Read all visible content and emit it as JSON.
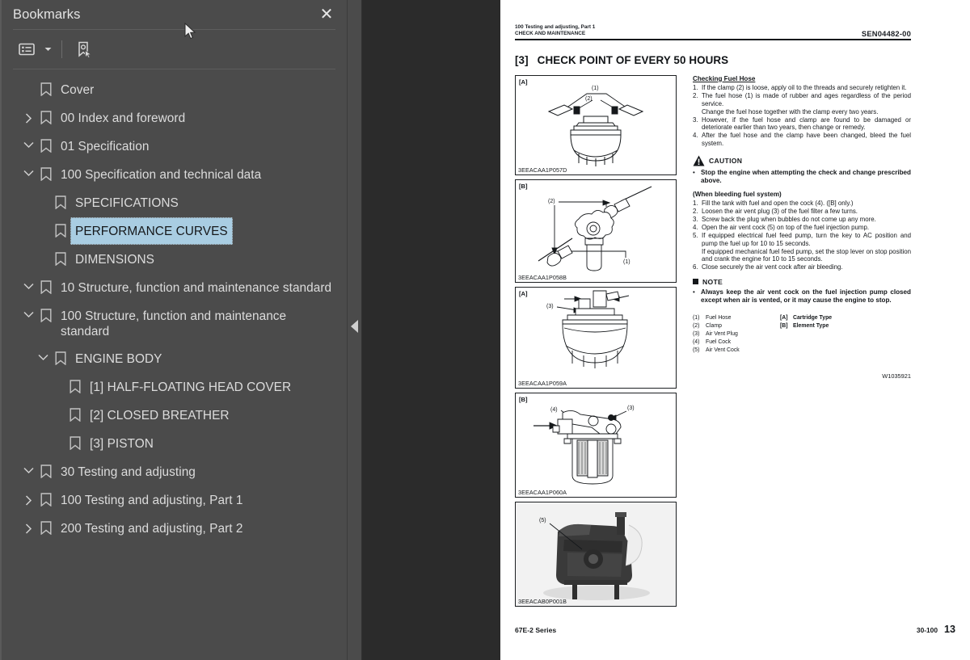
{
  "panel": {
    "title": "Bookmarks",
    "close_label": "✕",
    "toolbar": {
      "options_icon": "list-options-icon",
      "caret_icon": "chevron-down-icon",
      "find_bookmark_icon": "find-current-bookmark-icon"
    },
    "highlight_color": "#a9cde2",
    "items": [
      {
        "label": "Cover",
        "level": 1,
        "twisty": "none",
        "selected": false
      },
      {
        "label": "00 Index and foreword",
        "level": 0,
        "twisty": "collapsed",
        "selected": false
      },
      {
        "label": "01 Specification",
        "level": 0,
        "twisty": "expanded",
        "selected": false
      },
      {
        "label": "100 Specification and technical data",
        "level": 1,
        "twisty": "expanded",
        "selected": false
      },
      {
        "label": "SPECIFICATIONS",
        "level": 2,
        "twisty": "none",
        "selected": false
      },
      {
        "label": "PERFORMANCE CURVES",
        "level": 2,
        "twisty": "none",
        "selected": true
      },
      {
        "label": "DIMENSIONS",
        "level": 2,
        "twisty": "none",
        "selected": false
      },
      {
        "label": "10 Structure, function and maintenance standard",
        "level": 0,
        "twisty": "expanded",
        "selected": false
      },
      {
        "label": "100 Structure, function and maintenance standard",
        "level": 1,
        "twisty": "expanded",
        "selected": false
      },
      {
        "label": "ENGINE BODY",
        "level": 2,
        "twisty": "expanded",
        "selected": false
      },
      {
        "label": "[1] HALF-FLOATING HEAD COVER",
        "level": 3,
        "twisty": "none",
        "selected": false
      },
      {
        "label": "[2] CLOSED BREATHER",
        "level": 3,
        "twisty": "none",
        "selected": false
      },
      {
        "label": "[3] PISTON",
        "level": 3,
        "twisty": "none",
        "selected": false
      },
      {
        "label": "30 Testing and adjusting",
        "level": 0,
        "twisty": "expanded",
        "selected": false
      },
      {
        "label": "100 Testing and adjusting, Part 1",
        "level": 1,
        "twisty": "collapsed",
        "selected": false
      },
      {
        "label": "200 Testing and adjusting, Part 2",
        "level": 1,
        "twisty": "collapsed",
        "selected": false
      }
    ]
  },
  "viewer": {
    "collapse_handle_icon": "collapse-left-triangle-icon"
  },
  "document": {
    "header": {
      "line1": "100 Testing and adjusting, Part 1",
      "line2": "CHECK AND MAINTENANCE",
      "doc_number": "SEN04482-00"
    },
    "section": {
      "number": "[3]",
      "title": "CHECK POINT OF EVERY 50 HOURS"
    },
    "figures": [
      {
        "tag": "[A]",
        "code": "3EEACAA1P057D",
        "callouts": [
          "(1)",
          "(2)"
        ],
        "caption": "cartridge-type fuel filter with clamps"
      },
      {
        "tag": "[B]",
        "code": "3EEACAA1P058B",
        "callouts": [
          "(2)",
          "(1)"
        ],
        "caption": "element-type fuel filter with hoses"
      },
      {
        "tag": "[A]",
        "code": "3EEACAA1P059A",
        "callouts": [
          "(3)"
        ],
        "caption": "cartridge fuel filter air vent plug"
      },
      {
        "tag": "[B]",
        "code": "3EEACAA1P060A",
        "callouts": [
          "(4)",
          "(3)"
        ],
        "caption": "element fuel filter cut-away"
      },
      {
        "tag": "",
        "code": "3EEACAB0P001B",
        "callouts": [
          "(5)"
        ],
        "caption": "engine photo with air vent cock"
      }
    ],
    "body": {
      "heading": "Checking Fuel Hose",
      "steps": [
        {
          "n": "1.",
          "text": "If the clamp (2) is loose, apply oil to the threads and securely retighten it."
        },
        {
          "n": "2.",
          "text": "The fuel hose (1) is made of rubber and ages regardless of the period service.",
          "cont": "Change the fuel hose together with the clamp every two years."
        },
        {
          "n": "3.",
          "text": "However, if the fuel hose and clamp are found to be damaged or deteriorate earlier than two years, then change or remedy."
        },
        {
          "n": "4.",
          "text": "After the fuel hose and the clamp have been changed, bleed the fuel system."
        }
      ],
      "caution": {
        "label": "CAUTION",
        "icon": "warning-triangle-icon",
        "bullet": "•",
        "text": "Stop the engine when attempting the check and change prescribed above."
      },
      "bleed_heading": "(When bleeding fuel system)",
      "bleed_steps": [
        {
          "n": "1.",
          "text": "Fill the tank with fuel and open the cock (4).  ([B] only.)"
        },
        {
          "n": "2.",
          "text": "Loosen the air vent plug (3) of the fuel filter a few turns."
        },
        {
          "n": "3.",
          "text": "Screw back the plug when bubbles do not come up any more."
        },
        {
          "n": "4.",
          "text": "Open the air vent cock (5) on top of the fuel injection pump."
        },
        {
          "n": "5.",
          "text": "If equipped electrical fuel feed pump, turn the key to AC position and pump the fuel up for 10 to 15 seconds.",
          "cont": "If equipped mechanical fuel feed pump, set the stop lever on stop position and crank the engine for 10 to 15 seconds."
        },
        {
          "n": "6.",
          "text": "Close securely the air vent cock after air bleeding."
        }
      ],
      "note": {
        "label": "NOTE",
        "icon": "square-bullet-icon",
        "bullet": "•",
        "text": "Always keep the air vent cock on the fuel injection pump closed except when air is vented, or it may cause the engine to stop."
      },
      "legend_left": [
        {
          "k": "(1)",
          "v": "Fuel Hose"
        },
        {
          "k": "(2)",
          "v": "Clamp"
        },
        {
          "k": "(3)",
          "v": "Air Vent Plug"
        },
        {
          "k": "(4)",
          "v": "Fuel Cock"
        },
        {
          "k": "(5)",
          "v": "Air Vent Cock"
        }
      ],
      "legend_right": [
        {
          "k": "[A]",
          "v": "Cartridge Type"
        },
        {
          "k": "[B]",
          "v": "Element Type"
        }
      ],
      "work_code": "W1035921"
    },
    "footer": {
      "series": "67E-2 Series",
      "section_code": "30-100",
      "page_number": "13"
    }
  }
}
